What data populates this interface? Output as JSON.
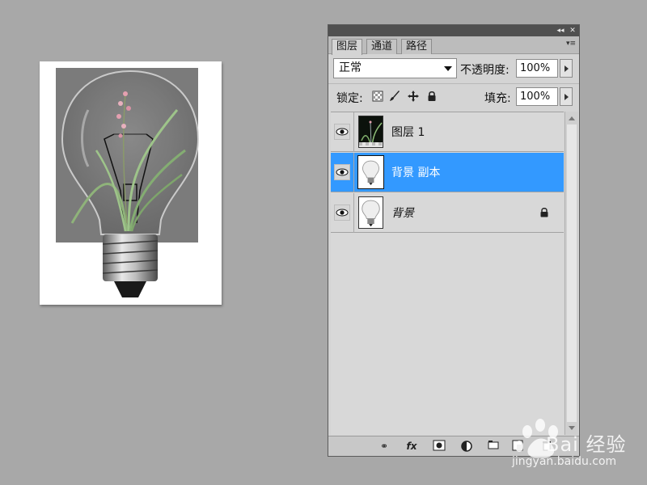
{
  "panel": {
    "tabs": [
      {
        "label": "图层",
        "active": true
      },
      {
        "label": "通道",
        "active": false
      },
      {
        "label": "路径",
        "active": false
      }
    ],
    "blend_mode": "正常",
    "opacity_label": "不透明度:",
    "opacity_value": "100%",
    "lock_label": "锁定:",
    "fill_label": "填充:",
    "fill_value": "100%",
    "layers": [
      {
        "name": "图层 1",
        "selected": false,
        "visible": true,
        "locked": false
      },
      {
        "name": "背景 副本",
        "selected": true,
        "visible": true,
        "locked": false
      },
      {
        "name": "背景",
        "selected": false,
        "visible": true,
        "locked": true
      }
    ],
    "bottom_icons": [
      "link-icon",
      "fx-icon",
      "mask-icon",
      "adjustment-icon",
      "group-icon",
      "new-layer-icon",
      "trash-icon"
    ],
    "bottom_fx_label": "fx"
  },
  "watermark": {
    "brand": "Bai 经验",
    "url": "jingyan.baidu.com"
  },
  "colors": {
    "selection": "#3399ff",
    "workspace": "#a8a8a8",
    "panel": "#d4d4d4"
  }
}
